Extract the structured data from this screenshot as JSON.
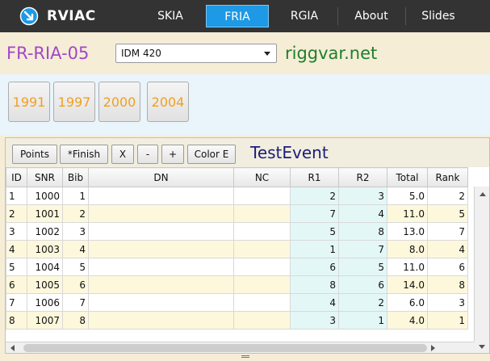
{
  "nav": {
    "brand": "RVIAC",
    "items": [
      "SKIA",
      "FRIA",
      "RGIA",
      "About",
      "Slides"
    ],
    "active": "FRIA",
    "active_color": "#1d99e6"
  },
  "header": {
    "event_code": "FR-RIA-05",
    "event_select": "IDM 420",
    "site": "riggvar.net"
  },
  "years": [
    "1991",
    "1997",
    "2000",
    "2004"
  ],
  "toolbar": {
    "points": "Points",
    "finish": "*Finish",
    "x": "X",
    "minus": "-",
    "plus": "+",
    "color": "Color E",
    "event_name": "TestEvent"
  },
  "table": {
    "columns": [
      "ID",
      "SNR",
      "Bib",
      "DN",
      "NC",
      "R1",
      "R2",
      "Total",
      "Rank"
    ],
    "rows": [
      [
        "1",
        "1000",
        "1",
        "",
        "",
        "2",
        "3",
        "5.0",
        "2"
      ],
      [
        "2",
        "1001",
        "2",
        "",
        "",
        "7",
        "4",
        "11.0",
        "5"
      ],
      [
        "3",
        "1002",
        "3",
        "",
        "",
        "5",
        "8",
        "13.0",
        "7"
      ],
      [
        "4",
        "1003",
        "4",
        "",
        "",
        "1",
        "7",
        "8.0",
        "4"
      ],
      [
        "5",
        "1004",
        "5",
        "",
        "",
        "6",
        "5",
        "11.0",
        "6"
      ],
      [
        "6",
        "1005",
        "6",
        "",
        "",
        "8",
        "6",
        "14.0",
        "8"
      ],
      [
        "7",
        "1006",
        "7",
        "",
        "",
        "4",
        "2",
        "6.0",
        "3"
      ],
      [
        "8",
        "1007",
        "8",
        "",
        "",
        "3",
        "1",
        "4.0",
        "1"
      ]
    ]
  }
}
